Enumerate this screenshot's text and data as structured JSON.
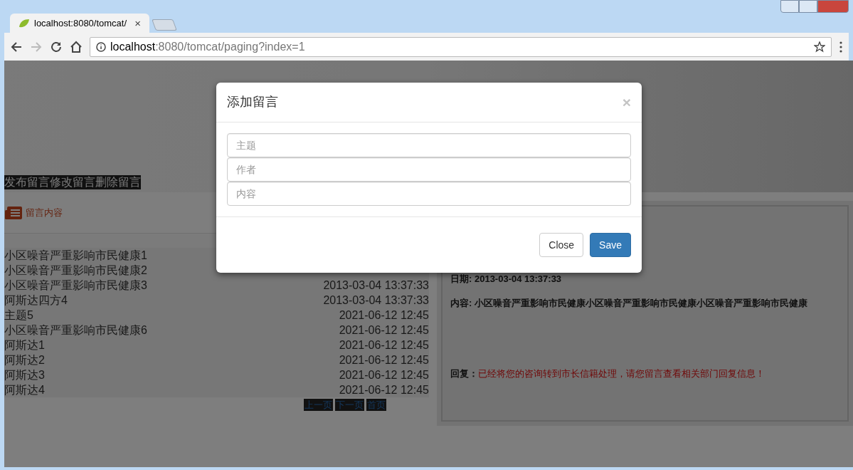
{
  "browser": {
    "tab_title": "localhost:8080/tomcat/",
    "tab_close": "×",
    "url_host": "localhost",
    "url_rest": ":8080/tomcat/paging?index=1"
  },
  "page": {
    "nav_links": [
      "发布留言",
      "修改留言",
      "删除留言"
    ],
    "section_title": "留言内容",
    "messages": [
      {
        "title": "小区噪音严重影响市民健康1"
      },
      {
        "title": "小区噪音严重影响市民健康2"
      },
      {
        "title": "小区噪音严重影响市民健康3",
        "date": "2013-03-04 13:37:33"
      },
      {
        "title": "阿斯达四方4",
        "date": "2013-03-04 13:37:33"
      },
      {
        "title": "主题5",
        "date": "2021-06-12 12:45"
      },
      {
        "title": "小区噪音严重影响市民健康6",
        "date": "2021-06-12 12:45"
      },
      {
        "title": "阿斯达1",
        "date": "2021-06-12 12:45"
      },
      {
        "title": "阿斯达2",
        "date": "2021-06-12 12:45"
      },
      {
        "title": "阿斯达3",
        "date": "2021-06-12 12:45"
      },
      {
        "title": "阿斯达4",
        "date": "2021-06-12 12:45"
      }
    ],
    "pagination": [
      "上一页",
      "下一页",
      "首页"
    ],
    "detail": {
      "date_line": "日期: 2013-03-04 13:37:33",
      "content_line": "内容: 小区噪音严重影响市民健康小区噪音严重影响市民健康小区噪音严重影响市民健康",
      "reply_label": "回复：",
      "reply": "已经将您的咨询转到市长信籍处理，请您留言查看相关部门回复信息！"
    }
  },
  "modal": {
    "title": "添加留言",
    "close_symbol": "×",
    "fields": [
      {
        "placeholder": "主题"
      },
      {
        "placeholder": "作者"
      },
      {
        "placeholder": "内容"
      }
    ],
    "buttons": [
      {
        "label": "Close",
        "kind": "default"
      },
      {
        "label": "Save",
        "kind": "primary"
      }
    ]
  }
}
